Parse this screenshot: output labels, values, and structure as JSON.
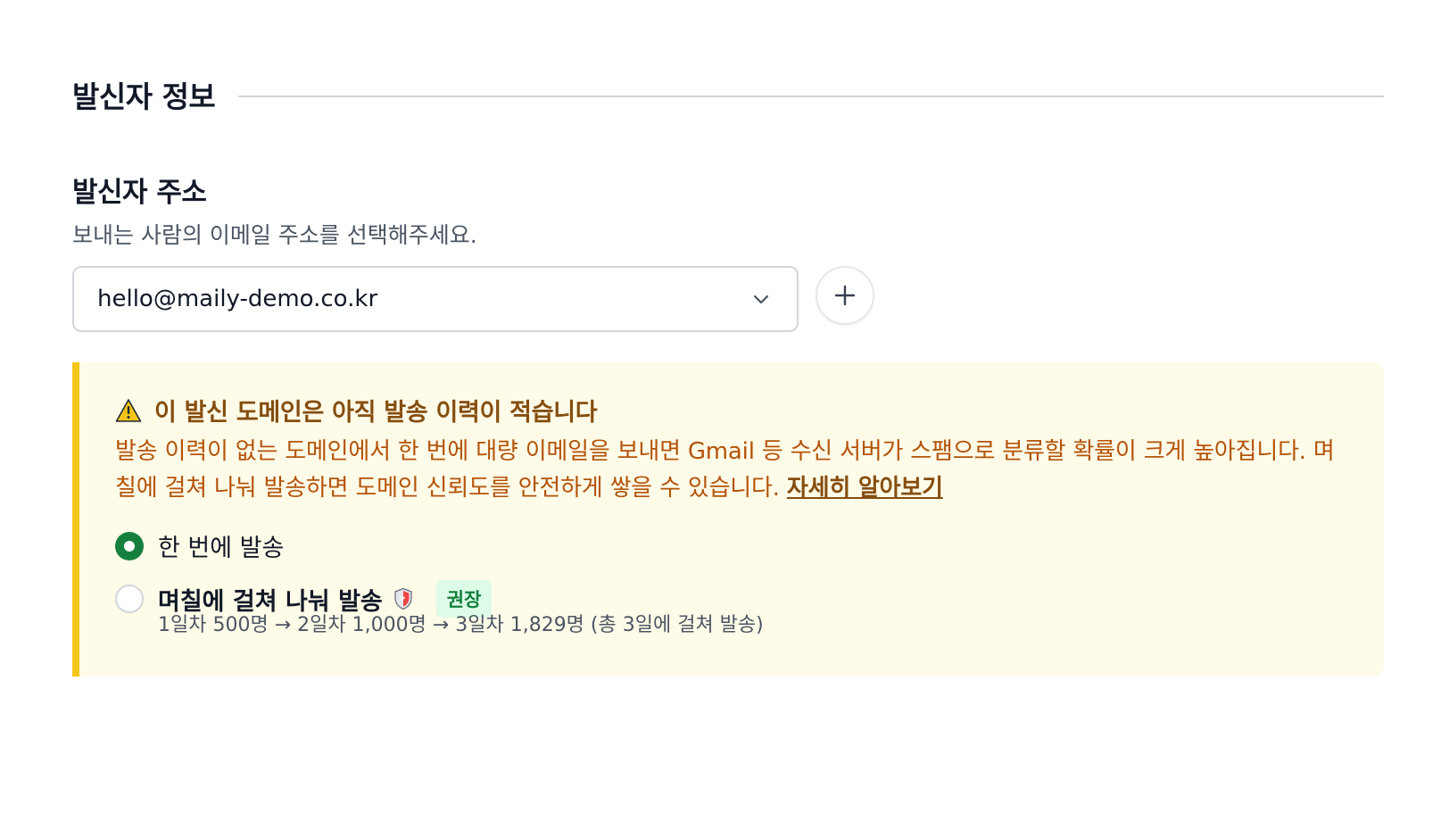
{
  "section": {
    "title": "발신자 정보"
  },
  "sender": {
    "label": "발신자 주소",
    "help": "보내는 사람의 이메일 주소를 선택해주세요.",
    "selected_email": "hello@maily-demo.co.kr",
    "dropdown_icon": "chevron-down-icon",
    "add_icon": "plus-icon"
  },
  "alert": {
    "icon": "warning-icon",
    "title": "이 발신 도메인은 아직 발송 이력이 적습니다",
    "body": "발송 이력이 없는 도메인에서 한 번에 대량 이메일을 보내면 Gmail 등 수신 서버가 스팸으로 분류할 확률이 크게 높아집니다. 며칠에 걸쳐 나눠 발송하면 도메인 신뢰도를 안전하게 쌓을 수 있습니다.",
    "link": "자세히 알아보기",
    "colors": {
      "background": "#fefbe8",
      "border": "#f5c518",
      "text": "#b45309"
    }
  },
  "options": [
    {
      "label": "한 번에 발송",
      "selected": true
    },
    {
      "label": "며칠에 걸쳐 나눠 발송",
      "selected": false,
      "icon": "shield-icon",
      "badge": "권장",
      "detail": "1일차 500명 → 2일차 1,000명 → 3일차 1,829명 (총 3일에 걸쳐 발송)"
    }
  ],
  "accent_color": "#15803d"
}
